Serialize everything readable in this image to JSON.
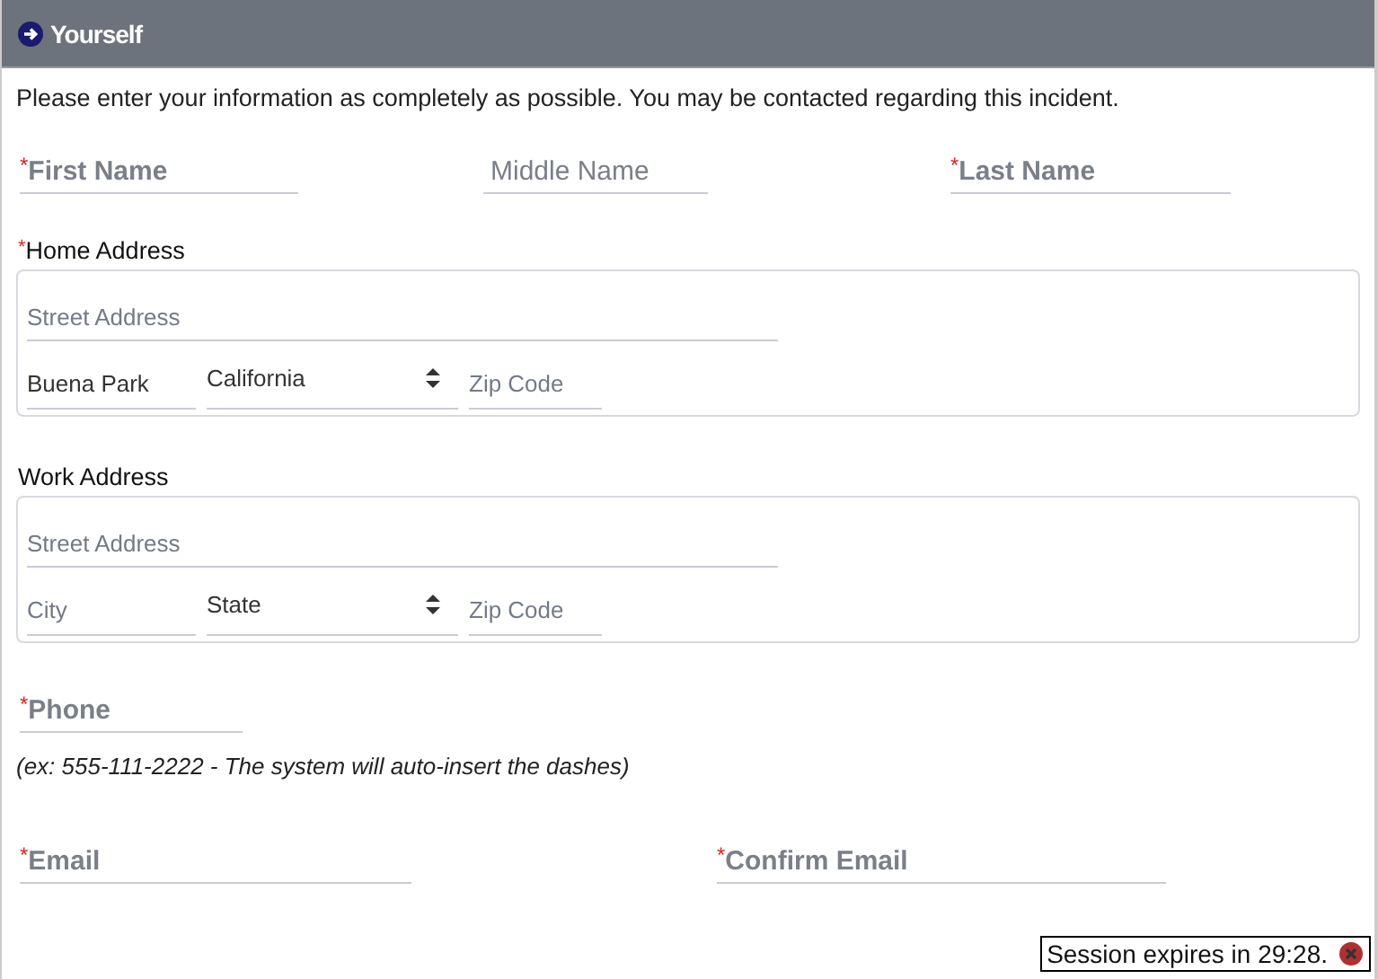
{
  "section": {
    "title": "Yourself"
  },
  "intro": "Please enter your information as completely as possible. You may be contacted regarding this incident.",
  "name_fields": [
    {
      "placeholder": "First Name",
      "required_mark": "*"
    },
    {
      "placeholder": "Middle Name"
    },
    {
      "placeholder": "Last Name",
      "required_mark": "*"
    }
  ],
  "addresses": [
    {
      "label": "Home Address",
      "required_mark": "*",
      "street": {
        "placeholder": "Street Address"
      },
      "city": {
        "value": "Buena Park"
      },
      "state": {
        "value": "California"
      },
      "zip": {
        "placeholder": "Zip Code"
      }
    },
    {
      "label": "Work Address",
      "street": {
        "placeholder": "Street Address"
      },
      "city": {
        "placeholder": "City"
      },
      "state": {
        "value": "State"
      },
      "zip": {
        "placeholder": "Zip Code"
      }
    }
  ],
  "phone": {
    "placeholder": "Phone",
    "required_mark": "*",
    "hint": "(ex: 555-111-2222 - The system will auto-insert the dashes)"
  },
  "email_fields": [
    {
      "placeholder": "Email",
      "required_mark": "*"
    },
    {
      "placeholder": "Confirm Email",
      "required_mark": "*"
    }
  ],
  "session_notice": {
    "text": "Session expires in 29:28."
  }
}
